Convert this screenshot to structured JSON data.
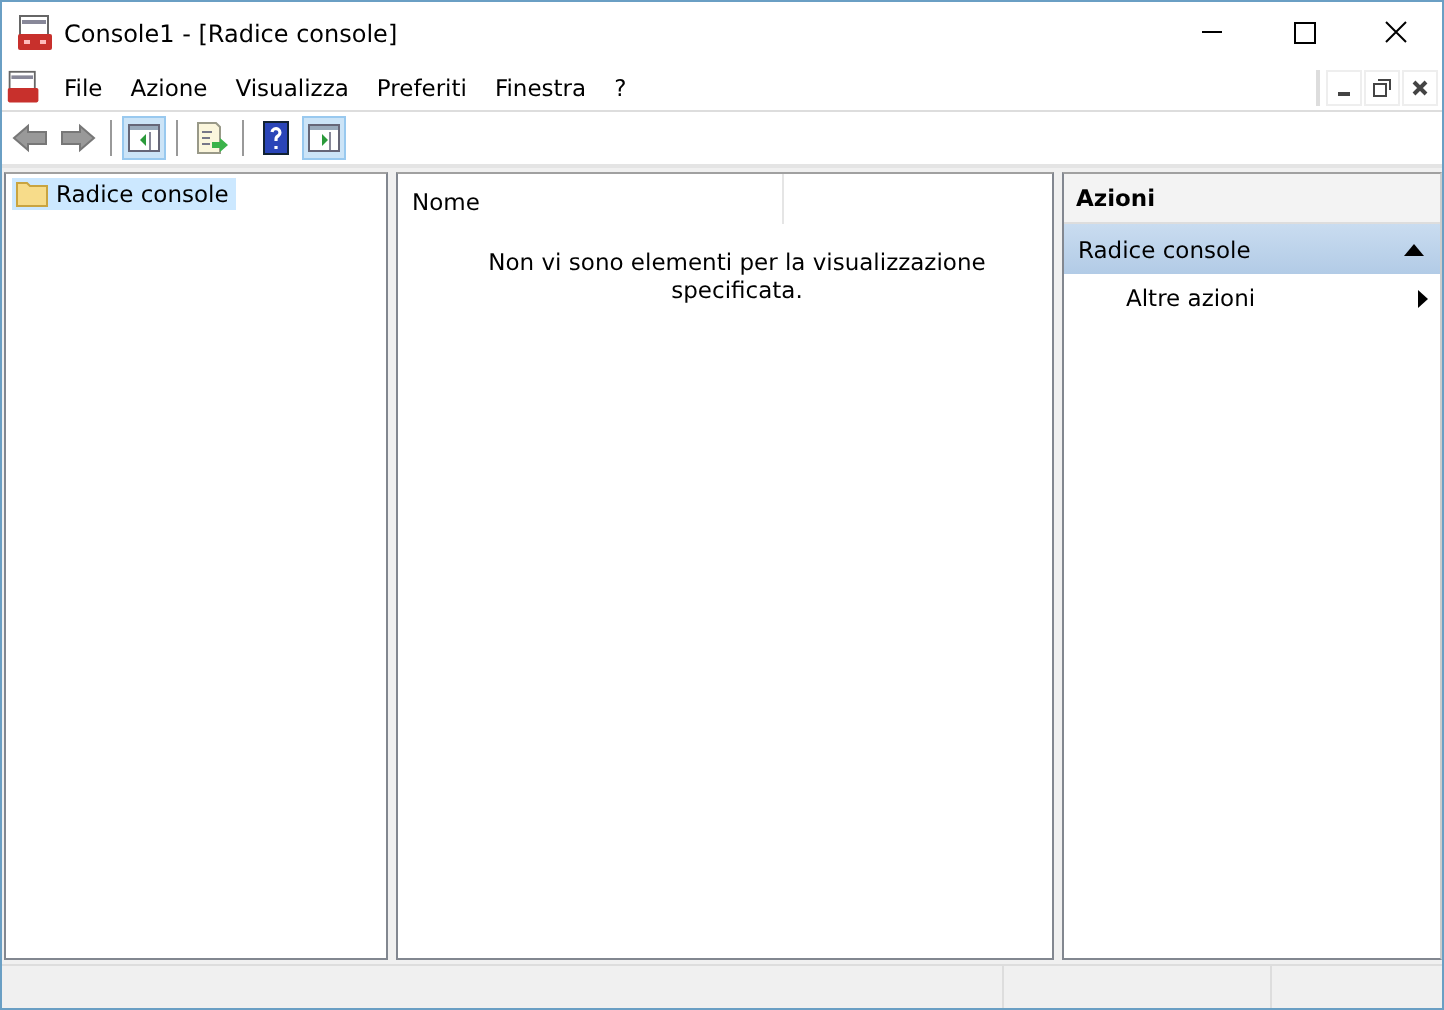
{
  "window": {
    "title": "Console1 - [Radice console]"
  },
  "menu": [
    "File",
    "Azione",
    "Visualizza",
    "Preferiti",
    "Finestra",
    "?"
  ],
  "toolbar": [
    {
      "kind": "back",
      "pressed": false
    },
    {
      "kind": "forward",
      "pressed": false
    },
    {
      "kind": "tree-toggle",
      "pressed": true
    },
    {
      "kind": "export",
      "pressed": false
    },
    {
      "kind": "help",
      "pressed": false
    },
    {
      "kind": "action-toggle",
      "pressed": true
    }
  ],
  "tree": {
    "items": [
      {
        "label": "Radice console",
        "selected": true
      }
    ]
  },
  "list": {
    "columns": [
      "Nome"
    ],
    "empty_message": "Non vi sono elementi per la visualizzazione specificata."
  },
  "actions": {
    "title": "Azioni",
    "sections": [
      {
        "label": "Radice console",
        "expanded": true,
        "items": [
          {
            "label": "Altre azioni"
          }
        ]
      }
    ]
  }
}
